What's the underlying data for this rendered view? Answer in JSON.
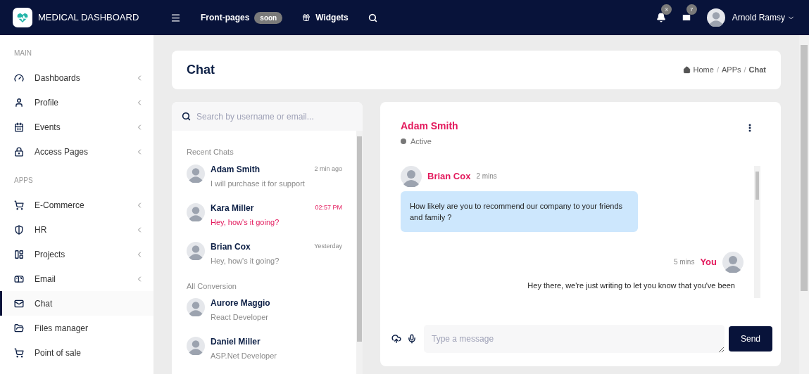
{
  "topbar": {
    "brand": "MEDICAL DASHBOARD",
    "nav": [
      {
        "kind": "menu"
      },
      {
        "kind": "link",
        "label": "Front-pages",
        "badge": "soon"
      },
      {
        "kind": "gift",
        "label": "Widgets"
      },
      {
        "kind": "search"
      }
    ],
    "notifications": "3",
    "messages": "7",
    "user": "Arnold Ramsy"
  },
  "sidebar": {
    "sections": [
      {
        "title": "MAIN",
        "items": [
          {
            "label": "Dashboards",
            "expandable": true,
            "selected": false
          },
          {
            "label": "Profile",
            "expandable": true,
            "selected": false
          },
          {
            "label": "Events",
            "expandable": true,
            "selected": false
          },
          {
            "label": "Access Pages",
            "expandable": true,
            "selected": false
          }
        ]
      },
      {
        "title": "APPS",
        "items": [
          {
            "label": "E-Commerce",
            "expandable": true,
            "selected": false
          },
          {
            "label": "HR",
            "expandable": true,
            "selected": false
          },
          {
            "label": "Projects",
            "expandable": true,
            "selected": false
          },
          {
            "label": "Email",
            "expandable": true,
            "selected": false
          },
          {
            "label": "Chat",
            "expandable": false,
            "selected": true
          },
          {
            "label": "Files manager",
            "expandable": false,
            "selected": false
          },
          {
            "label": "Point of sale",
            "expandable": false,
            "selected": false
          }
        ]
      }
    ]
  },
  "page": {
    "title": "Chat",
    "breadcrumb": [
      "Home",
      "APPs",
      "Chat"
    ],
    "separator": "/"
  },
  "chat_list": {
    "search_placeholder": "Search by username or email...",
    "groups": [
      {
        "title": "Recent Chats",
        "items": [
          {
            "name": "Adam Smith",
            "subtitle": "I will purchase it for support",
            "time": "2 min ago",
            "unread": false
          },
          {
            "name": "Kara Miller",
            "subtitle": "Hey, how's it going?",
            "time": "02:57 PM",
            "unread": true
          },
          {
            "name": "Brian Cox",
            "subtitle": "Hey, how's it going?",
            "time": "Yesterday",
            "unread": false
          }
        ]
      },
      {
        "title": "All Conversion",
        "items": [
          {
            "name": "Aurore Maggio",
            "subtitle": "React Developer",
            "unread": false
          },
          {
            "name": "Daniel Miller",
            "subtitle": "ASP.Net Developer",
            "unread": false
          }
        ]
      }
    ]
  },
  "conversation": {
    "name": "Adam Smith",
    "status": "Active",
    "messages": [
      {
        "kind": "incoming",
        "sender": "Brian Cox",
        "time": "2 mins",
        "text": "How likely are you to recommend our company to your friends and family ?"
      },
      {
        "kind": "outgoing",
        "sender": "You",
        "time": "5 mins",
        "text": "Hey there, we're just writing to let you know that you've been"
      }
    ],
    "input_placeholder": "Type a message",
    "send": "Send"
  }
}
